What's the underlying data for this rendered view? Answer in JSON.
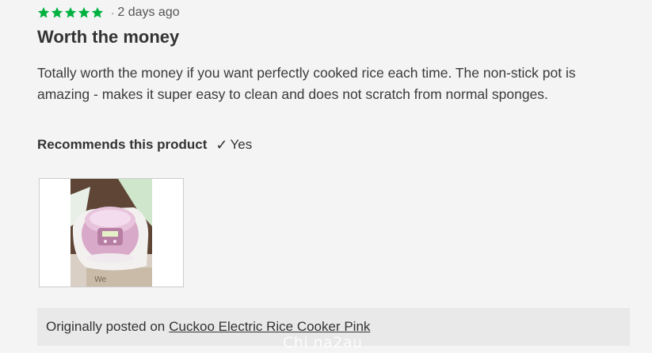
{
  "review": {
    "rating": 5,
    "rating_max": 5,
    "star_color": "#00b140",
    "separator": "·",
    "date": "2 days ago",
    "title": "Worth the money",
    "body": "Totally worth the money if you want perfectly cooked rice each time. The non-stick pot is amazing - makes it super easy to clean and does not scratch from normal sponges.",
    "recommend_label": "Recommends this product",
    "recommend_icon": "checkmark-icon",
    "recommend_check": "✓",
    "recommend_value": "Yes",
    "photo_subject": "pink rice cooker in packaging"
  },
  "origin": {
    "prefix": "Originally posted on",
    "product_link": "Cuckoo Electric Rice Cooker Pink"
  },
  "watermark": {
    "text": "Chi na2au"
  }
}
